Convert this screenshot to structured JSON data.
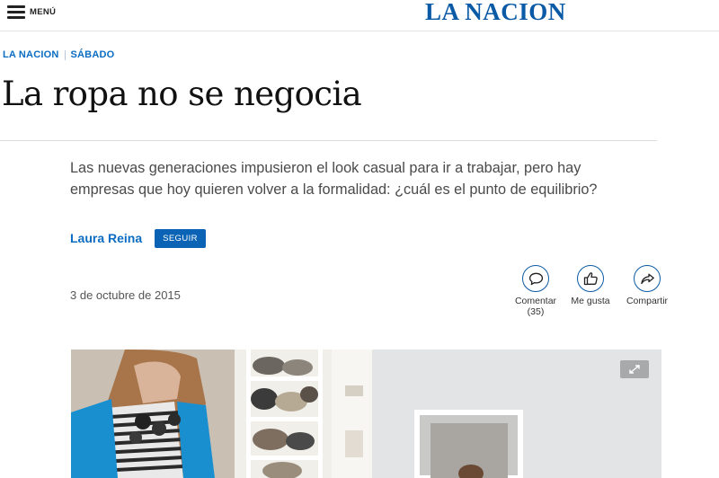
{
  "header": {
    "menu_label": "MENÚ",
    "logo_text": "LA NACION"
  },
  "breadcrumb": {
    "section": "LA NACION",
    "subsection": "SÁBADO"
  },
  "article": {
    "title": "La ropa no se negocia",
    "lead": "Las nuevas generaciones impusieron el look casual para ir a trabajar, pero hay empresas que hoy quieren volver a la formalidad: ¿cuál es el punto de equilibrio?",
    "author": "Laura Reina",
    "follow_label": "SEGUIR",
    "date": "3 de octubre de 2015"
  },
  "actions": {
    "comment": {
      "label": "Comentar",
      "count": "(35)",
      "icon": "comment-icon"
    },
    "like": {
      "label": "Me gusta",
      "icon": "thumbs-up-icon"
    },
    "share": {
      "label": "Compartir",
      "icon": "share-icon"
    }
  },
  "hero_image": {
    "expand_icon": "expand-icon"
  },
  "colors": {
    "brand": "#0a5aa6",
    "link": "#0a6cc2",
    "button": "#0a63b5"
  }
}
